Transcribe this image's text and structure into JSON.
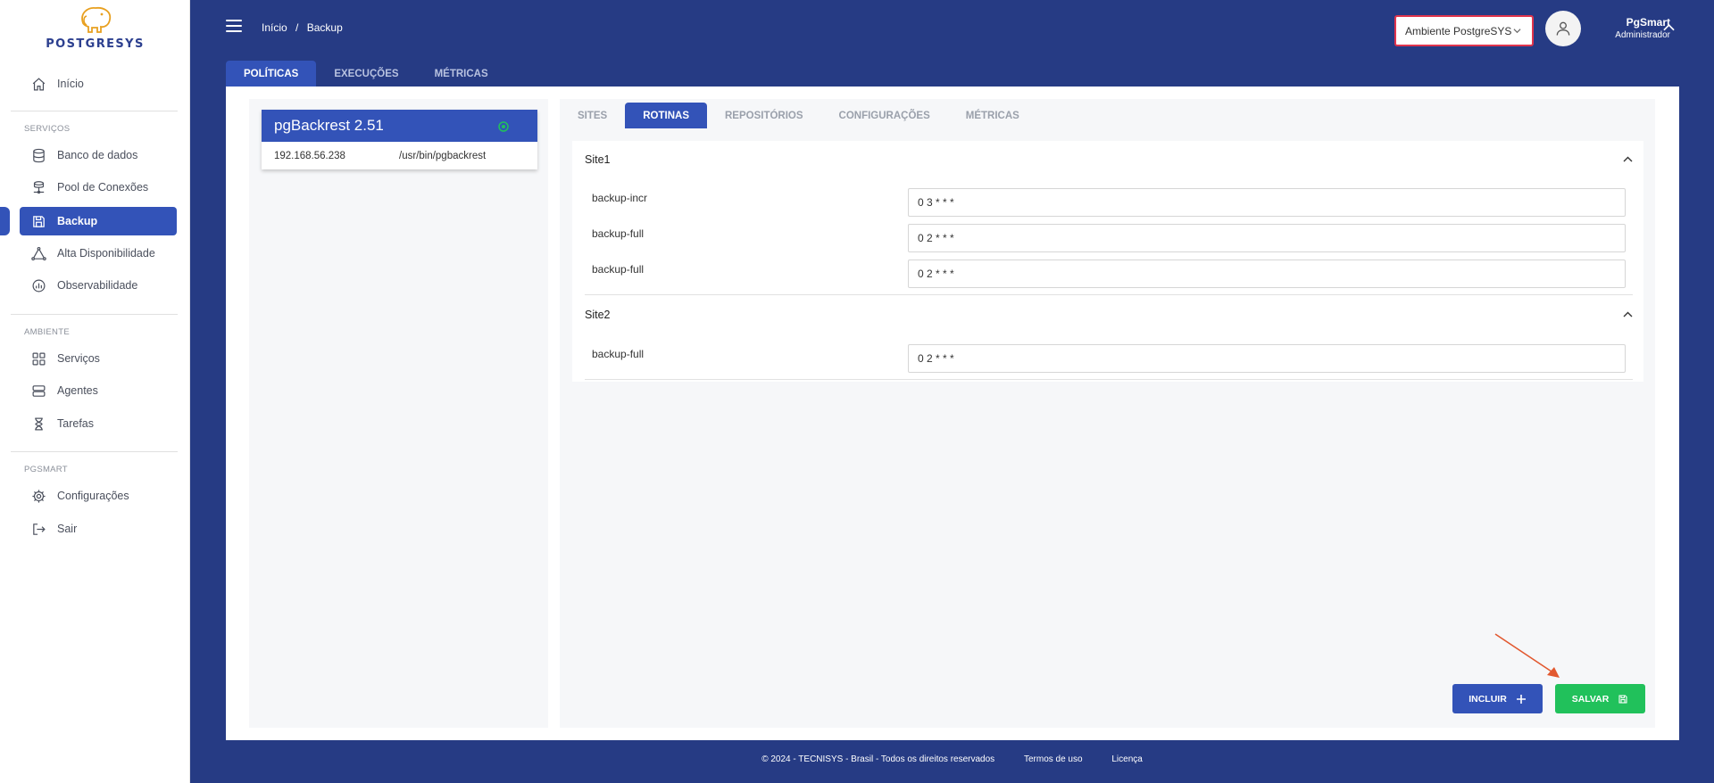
{
  "brand": {
    "name": "POSTGRESYS"
  },
  "sidebar": {
    "sections": {
      "servicos": "SERVIÇOS",
      "ambiente": "AMBIENTE",
      "pgsmart": "PGSMART"
    },
    "items": [
      {
        "label": "Início",
        "icon": "home-icon"
      },
      {
        "label": "Banco de dados",
        "icon": "database-icon"
      },
      {
        "label": "Pool de Conexões",
        "icon": "connection-pool-icon"
      },
      {
        "label": "Backup",
        "icon": "save-icon"
      },
      {
        "label": "Alta Disponibilidade",
        "icon": "triangle-nodes-icon"
      },
      {
        "label": "Observabilidade",
        "icon": "chart-circle-icon"
      },
      {
        "label": "Serviços",
        "icon": "grid-icon"
      },
      {
        "label": "Agentes",
        "icon": "server-icon"
      },
      {
        "label": "Tarefas",
        "icon": "hourglass-icon"
      },
      {
        "label": "Configurações",
        "icon": "gear-icon"
      },
      {
        "label": "Sair",
        "icon": "logout-icon"
      }
    ],
    "active_item": "Backup"
  },
  "header": {
    "breadcrumb": [
      "Início",
      "/",
      "Backup"
    ],
    "environment_select": "Ambiente PostgreSYS",
    "user": {
      "name": "PgSmart",
      "role": "Administrador"
    }
  },
  "main_tabs": [
    {
      "label": "POLÍTICAS",
      "active": true
    },
    {
      "label": "EXECUÇÕES",
      "active": false
    },
    {
      "label": "MÉTRICAS",
      "active": false
    }
  ],
  "backup_card": {
    "title": "pgBackrest 2.51",
    "ip": "192.168.56.238",
    "path": "/usr/bin/pgbackrest",
    "status_color": "#21c15b"
  },
  "sub_tabs": [
    {
      "label": "SITES",
      "active": false
    },
    {
      "label": "ROTINAS",
      "active": true
    },
    {
      "label": "REPOSITÓRIOS",
      "active": false
    },
    {
      "label": "CONFIGURAÇÕES",
      "active": false
    },
    {
      "label": "MÉTRICAS",
      "active": false
    }
  ],
  "sites": [
    {
      "name": "Site1",
      "routines": [
        {
          "label": "backup-incr",
          "value": "0 3 * * *"
        },
        {
          "label": "backup-full",
          "value": "0 2 * * *"
        },
        {
          "label": "backup-full",
          "value": "0 2 * * *"
        }
      ]
    },
    {
      "name": "Site2",
      "routines": [
        {
          "label": "backup-full",
          "value": "0 2 * * *"
        }
      ]
    }
  ],
  "actions": {
    "incluir": "INCLUIR",
    "salvar": "SALVAR"
  },
  "footer": {
    "copyright": "© 2024 - TECNISYS - Brasil - Todos os direitos reservados",
    "terms": "Termos de uso",
    "license": "Licença"
  },
  "colors": {
    "primary": "#3353b8",
    "navy": "#263b84",
    "success": "#21c15b",
    "alert": "#e0344d"
  }
}
